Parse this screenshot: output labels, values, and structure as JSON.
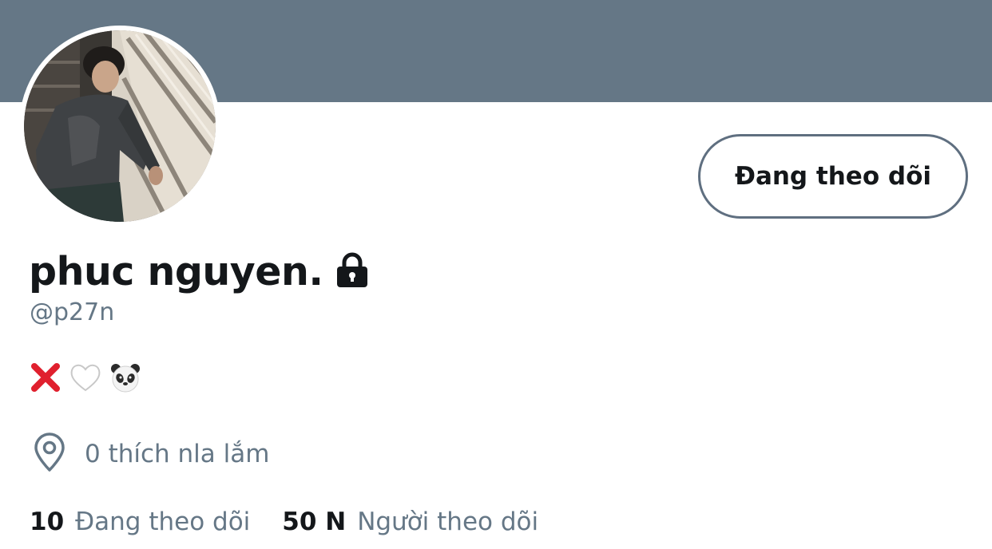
{
  "profile": {
    "display_name": "phuc nguyen.",
    "handle": "@p27n",
    "bio_emojis": [
      "cross-mark",
      "white-heart",
      "panda-face"
    ],
    "location": "0 thích nla lắm"
  },
  "actions": {
    "follow_button_label": "Đang theo dõi"
  },
  "stats": {
    "following": {
      "count": "10",
      "label": "Đang theo dõi"
    },
    "followers": {
      "count": "50 N",
      "label": "Người theo dõi"
    }
  },
  "icons": {
    "lock": "lock-icon",
    "location": "location-pin-icon"
  },
  "colors": {
    "banner": "#657786",
    "text_primary": "#14171a",
    "text_secondary": "#657786",
    "button_border": "#5f6f80"
  }
}
